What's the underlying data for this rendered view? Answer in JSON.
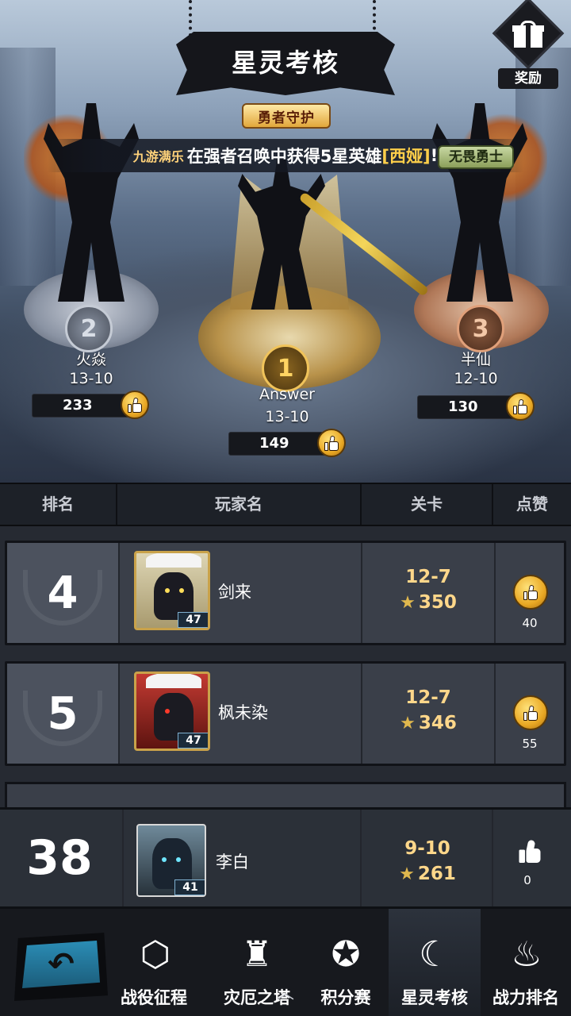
{
  "header": {
    "title": "星灵考核",
    "reward_label": "奖励",
    "guard_badge": "勇者守护",
    "fearless_badge": "无畏勇士"
  },
  "broadcast": {
    "guild_tag": "九游满乐",
    "text": "在强者召唤中获得5星英雄",
    "hero": "[西娅]",
    "suffix": "!"
  },
  "podium": [
    {
      "rank": "1",
      "name": "Answer",
      "stage": "13-10",
      "likes": "149"
    },
    {
      "rank": "2",
      "name": "火焱",
      "stage": "13-10",
      "likes": "233"
    },
    {
      "rank": "3",
      "name": "半仙",
      "stage": "12-10",
      "likes": "130"
    }
  ],
  "table": {
    "headers": {
      "rank": "排名",
      "player": "玩家名",
      "stage": "关卡",
      "like": "点赞"
    },
    "rows": [
      {
        "rank": "4",
        "name": "剑来",
        "level": "47",
        "stage": "12-7",
        "score": "350",
        "likes": "40"
      },
      {
        "rank": "5",
        "name": "枫未染",
        "level": "47",
        "stage": "12-7",
        "score": "346",
        "likes": "55"
      }
    ]
  },
  "my_row": {
    "rank": "38",
    "name": "李白",
    "level": "41",
    "stage": "9-10",
    "score": "261",
    "likes": "0"
  },
  "nav": {
    "items": [
      {
        "label": "战役征程",
        "icon": "hexagon-shield-icon"
      },
      {
        "label": "灾厄之塔",
        "icon": "tower-icon"
      },
      {
        "label": "积分赛",
        "icon": "winged-star-icon"
      },
      {
        "label": "星灵考核",
        "icon": "crescent-star-icon"
      },
      {
        "label": "战力排名",
        "icon": "flame-mask-icon"
      }
    ],
    "active": "星灵考核"
  },
  "colors": {
    "gold": "#ffd78a",
    "accent_blue": "#2b8db6",
    "panel": "#3a3f49"
  }
}
